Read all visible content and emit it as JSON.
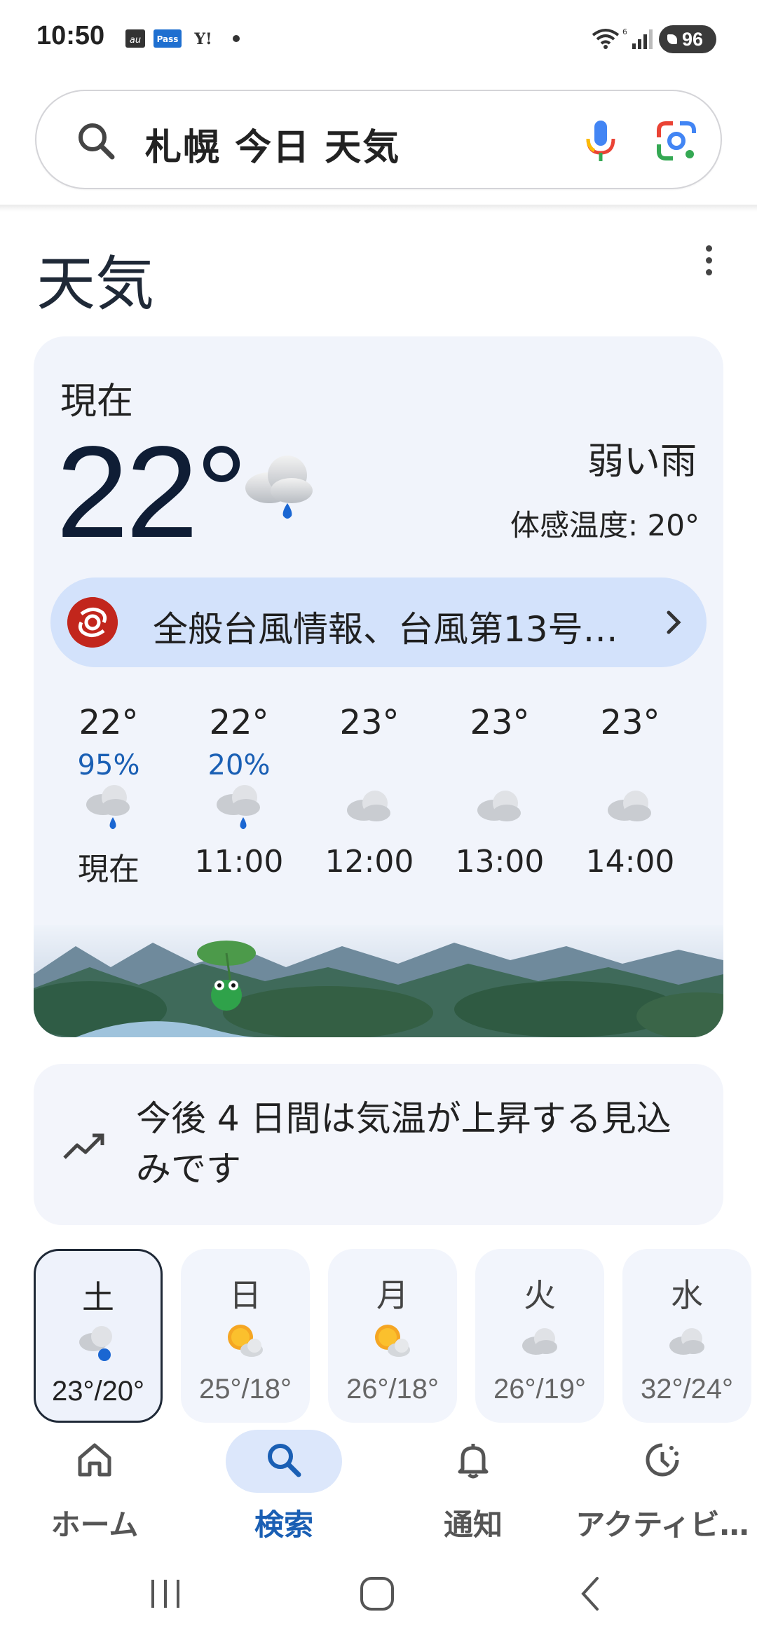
{
  "status_bar": {
    "time": "10:50",
    "notification_icons": [
      "au-icon",
      "pass-icon",
      "yahoo-icon",
      "dot-icon"
    ],
    "battery": "96"
  },
  "search": {
    "query": "札幌 今日 天気"
  },
  "section": {
    "title": "天気"
  },
  "current": {
    "label": "現在",
    "temperature": "22°",
    "condition": "弱い雨",
    "feels_like": "体感温度: 20°",
    "icon": "rain-cloud-icon"
  },
  "alert": {
    "text": "全般台風情報、台風第13号…"
  },
  "hourly": [
    {
      "temp": "22°",
      "precip": "95%",
      "time": "現在",
      "icon": "rain"
    },
    {
      "temp": "22°",
      "precip": "20%",
      "time": "11:00",
      "icon": "rain"
    },
    {
      "temp": "23°",
      "precip": "",
      "time": "12:00",
      "icon": "cloud"
    },
    {
      "temp": "23°",
      "precip": "",
      "time": "13:00",
      "icon": "cloud"
    },
    {
      "temp": "23°",
      "precip": "",
      "time": "14:00",
      "icon": "cloud"
    }
  ],
  "trend": {
    "text": "今後 4 日間は気温が上昇する見込みです"
  },
  "daily": [
    {
      "day": "土",
      "range": "23°/20°",
      "icon": "rain",
      "selected": true
    },
    {
      "day": "日",
      "range": "25°/18°",
      "icon": "sun-cloud",
      "selected": false
    },
    {
      "day": "月",
      "range": "26°/18°",
      "icon": "sun-cloud",
      "selected": false
    },
    {
      "day": "火",
      "range": "26°/19°",
      "icon": "cloud",
      "selected": false
    },
    {
      "day": "水",
      "range": "32°/24°",
      "icon": "cloud",
      "selected": false
    }
  ],
  "bottom_nav": [
    {
      "label": "ホーム",
      "icon": "home-icon",
      "active": false
    },
    {
      "label": "検索",
      "icon": "search-icon",
      "active": true
    },
    {
      "label": "通知",
      "icon": "bell-icon",
      "active": false
    },
    {
      "label": "アクティビ…",
      "icon": "activity-icon",
      "active": false
    }
  ],
  "colors": {
    "accent": "#1a5fb4",
    "card_bg": "#f1f4fb",
    "alert_bg": "#d3e2fb",
    "alert_badge": "#c2261c"
  }
}
